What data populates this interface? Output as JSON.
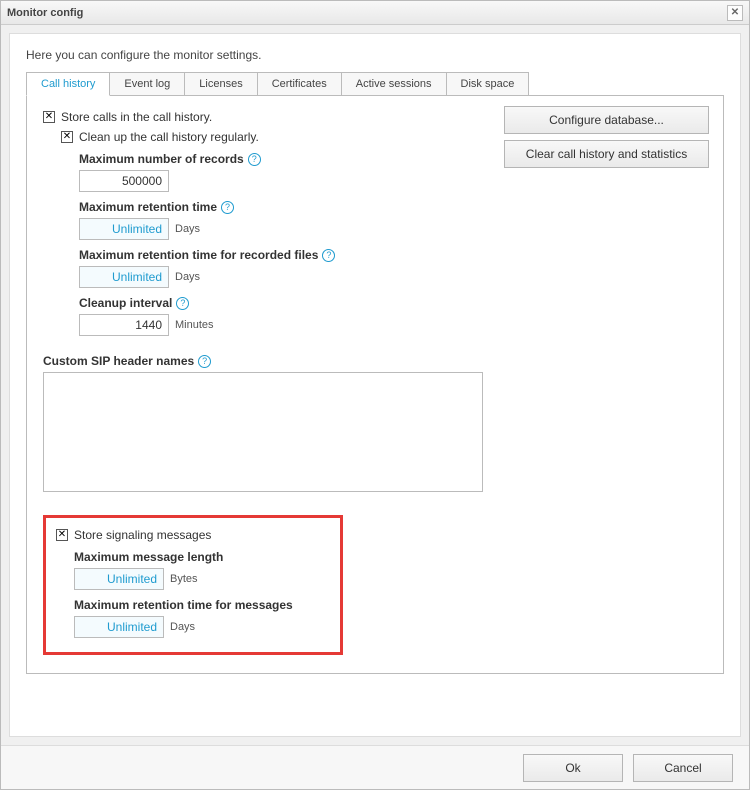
{
  "window": {
    "title": "Monitor config"
  },
  "intro": "Here you can configure the monitor settings.",
  "tabs": [
    {
      "label": "Call history"
    },
    {
      "label": "Event log"
    },
    {
      "label": "Licenses"
    },
    {
      "label": "Certificates"
    },
    {
      "label": "Active sessions"
    },
    {
      "label": "Disk space"
    }
  ],
  "buttons": {
    "configure_db": "Configure database...",
    "clear_history": "Clear call history and statistics"
  },
  "call_history": {
    "store_calls": {
      "label": "Store calls in the call history.",
      "checked": true
    },
    "cleanup": {
      "label": "Clean up the call history regularly.",
      "checked": true
    },
    "max_records": {
      "label": "Maximum number of records",
      "value": "500000"
    },
    "max_retention": {
      "label": "Maximum retention time",
      "value": "Unlimited",
      "unit": "Days"
    },
    "max_retention_files": {
      "label": "Maximum retention time for recorded files",
      "value": "Unlimited",
      "unit": "Days"
    },
    "cleanup_interval": {
      "label": "Cleanup interval",
      "value": "1440",
      "unit": "Minutes"
    },
    "custom_sip": {
      "label": "Custom SIP header names",
      "value": ""
    }
  },
  "signaling": {
    "store": {
      "label": "Store signaling messages",
      "checked": true
    },
    "max_length": {
      "label": "Maximum message length",
      "value": "Unlimited",
      "unit": "Bytes"
    },
    "max_retention": {
      "label": "Maximum retention time for messages",
      "value": "Unlimited",
      "unit": "Days"
    }
  },
  "footer": {
    "ok": "Ok",
    "cancel": "Cancel"
  },
  "help_glyph": "?",
  "check_glyph": "✕"
}
